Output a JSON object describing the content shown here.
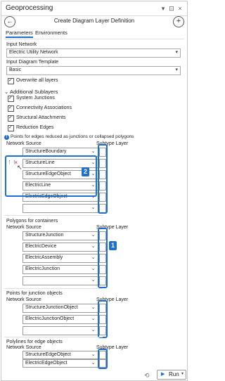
{
  "app_title": "Geoprocessing",
  "title_buttons": {
    "pin": "▾",
    "autohide": "⊡",
    "close": "×"
  },
  "tool": {
    "back_icon": "back-arrow-icon",
    "title": "Create Diagram Layer Definition",
    "add": "+"
  },
  "tabs": [
    {
      "label": "Parameters",
      "active": true
    },
    {
      "label": "Environments",
      "active": false
    }
  ],
  "input_network": {
    "label": "Input Network",
    "value": "Electric Utility Network"
  },
  "input_template": {
    "label": "Input Diagram Template",
    "value": "Basic"
  },
  "overwrite": {
    "label": "Overwrite all layers",
    "checked": true
  },
  "additional": {
    "header": "Additional Sublayers",
    "items": [
      {
        "label": "System Junctions",
        "checked": true
      },
      {
        "label": "Connectivity Associations",
        "checked": true
      },
      {
        "label": "Structural Attachments",
        "checked": true
      },
      {
        "label": "Reduction Edges",
        "checked": true
      }
    ]
  },
  "points_edges": {
    "heading": "Points for edges reduced as junctions or collapsed polygons",
    "network_source_label": "Network Source",
    "subtype_label": "Subtype Layer",
    "rows": [
      "StructureBoundary",
      "StructureLine",
      "StructureEdgeObject",
      "ElectricLine",
      "ElectricEdgeObject",
      ""
    ]
  },
  "polygons": {
    "heading": "Polygons for containers",
    "network_source_label": "Network Source",
    "subtype_label": "Subtype Layer",
    "rows": [
      "StructureJunction",
      "ElectricDevice",
      "ElectricAssembly",
      "ElectricJunction",
      ""
    ]
  },
  "points_junction": {
    "heading": "Points for junction objects",
    "network_source_label": "Network Source",
    "subtype_label": "Subtype Layer",
    "rows": [
      "StructureJunctionObject",
      "ElectricJunctionObject",
      ""
    ]
  },
  "polylines": {
    "heading": "Polylines for edge objects",
    "network_source_label": "Network Source",
    "subtype_label": "Subtype Layer",
    "rows": [
      "StructureEdgeObject",
      "ElectricEdgeObject",
      ""
    ]
  },
  "badges": {
    "one": "1",
    "two": "2"
  },
  "run": {
    "label": "Run"
  },
  "colors": {
    "accent": "#1e6fd0",
    "border": "#9a9a9a"
  }
}
